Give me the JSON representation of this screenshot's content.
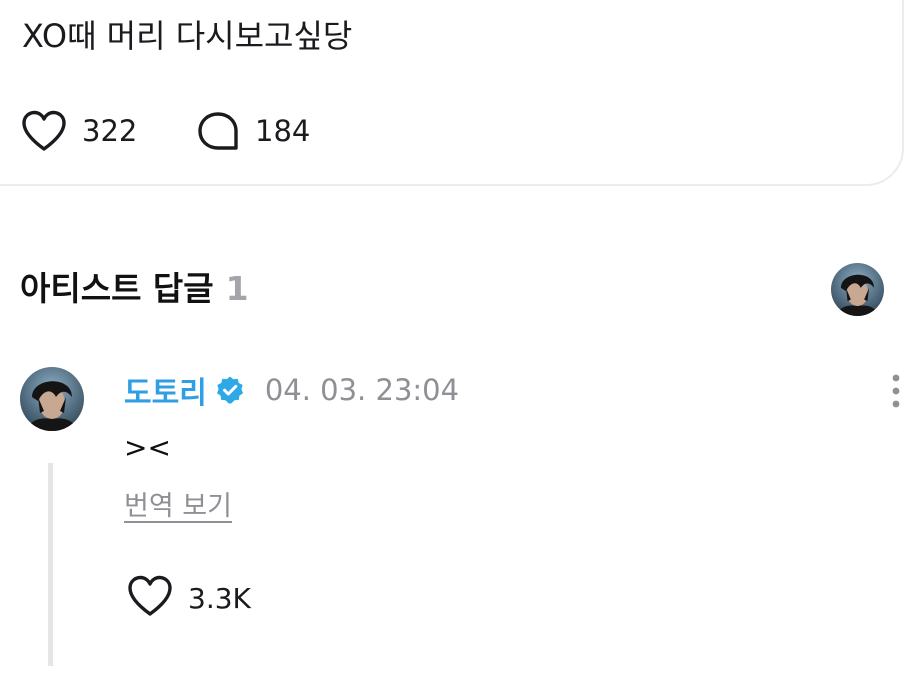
{
  "post": {
    "text": "XO때 머리 다시보고싶당",
    "like_count": "322",
    "comment_count": "184",
    "like_icon": "heart-outline-icon",
    "comment_icon": "speech-bubble-icon"
  },
  "artist_replies": {
    "title": "아티스트 답글",
    "count": "1",
    "header_avatar": "artist-avatar"
  },
  "reply": {
    "author": "도토리",
    "verified_icon": "verified-badge-icon",
    "timestamp": "04. 03. 23:04",
    "text": "><",
    "translate_label": "번역 보기",
    "like_count": "3.3K",
    "more_icon": "more-vertical-icon"
  },
  "colors": {
    "author_blue": "#2f9ee4",
    "verified_blue": "#2fa8e6",
    "muted_gray": "#8f8f95",
    "count_gray": "#a4a4aa",
    "text_dark": "#1b1b1f",
    "card_border": "#ececee"
  }
}
